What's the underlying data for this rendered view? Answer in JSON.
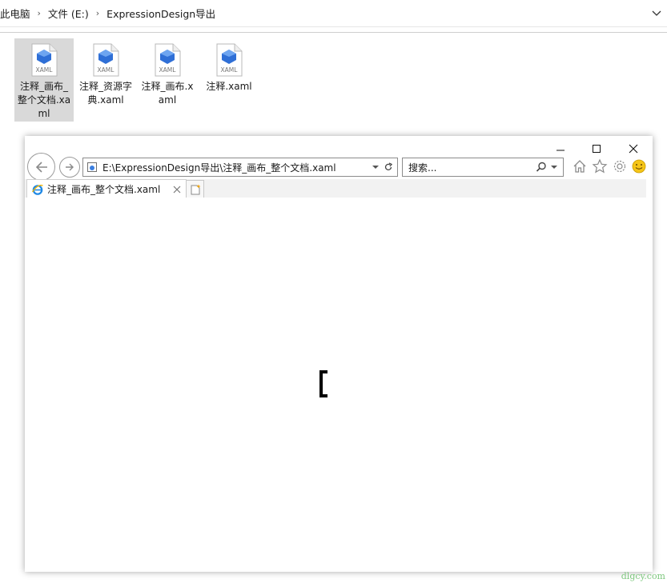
{
  "explorer": {
    "breadcrumb": [
      "此电脑",
      "文件 (E:)",
      "ExpressionDesign导出"
    ],
    "files": [
      {
        "name": "注释_画布_整个文档.xaml",
        "type": "XAML",
        "selected": true
      },
      {
        "name": "注释_资源字典.xaml",
        "type": "XAML",
        "selected": false
      },
      {
        "name": "注释_画布.xaml",
        "type": "XAML",
        "selected": false
      },
      {
        "name": "注释.xaml",
        "type": "XAML",
        "selected": false
      }
    ]
  },
  "browser": {
    "address": "E:\\ExpressionDesign导出\\注释_画布_整个文档.xaml",
    "search_placeholder": "搜索...",
    "tab_title": "注释_画布_整个文档.xaml",
    "content_text": "["
  },
  "icons": {
    "back": "back-arrow-icon",
    "forward": "forward-arrow-icon",
    "refresh": "refresh-icon",
    "search": "search-icon",
    "home": "home-icon",
    "favorites": "star-icon",
    "tools": "gear-icon",
    "feedback": "smiley-icon"
  },
  "colors": {
    "selection": "#d9d9d9",
    "ie_blue": "#1e88e5",
    "smiley": "#f5c518"
  },
  "watermark": "dlgcy.com"
}
